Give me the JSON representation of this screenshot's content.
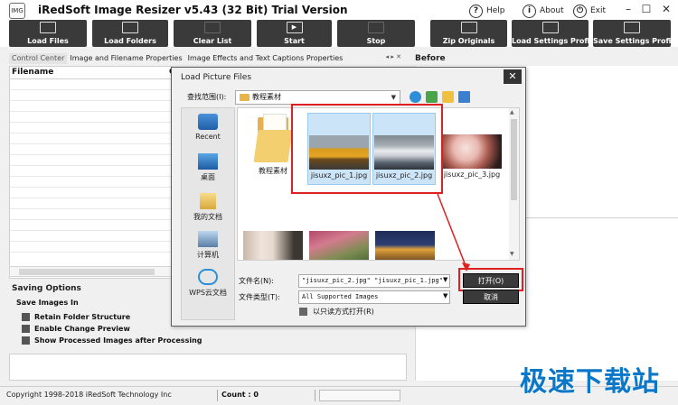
{
  "window": {
    "title": "iRedSoft Image Resizer v5.43 (32 Bit) Trial Version",
    "app_icon_text": "IMG",
    "links": [
      {
        "label": "Help",
        "icon": "?"
      },
      {
        "label": "About",
        "icon": "i"
      },
      {
        "label": "Exit",
        "icon": "⏻"
      }
    ],
    "controls": {
      "minimize": "–",
      "maximize": "☐",
      "close": "✕"
    }
  },
  "toolbar": {
    "buttons": [
      {
        "label": "Load Files",
        "icon": "image-icon"
      },
      {
        "label": "Load Folders",
        "icon": "image-icon"
      },
      {
        "label": "Clear List",
        "icon": "blank-icon"
      },
      {
        "label": "Start",
        "icon": "play-icon"
      },
      {
        "label": "Stop",
        "icon": "stop-icon"
      },
      {
        "label": "Zip Originals",
        "icon": "image-icon"
      },
      {
        "label": "Load Settings Profile",
        "icon": "image-icon"
      },
      {
        "label": "Save Settings Profile",
        "icon": "image-icon"
      }
    ]
  },
  "tabs": [
    "Control Center",
    "Image and Filename Properties",
    "Image Effects and Text Captions Properties"
  ],
  "tab_arrows": "◂ ▸ ✕",
  "preview": {
    "before_label": "Before"
  },
  "file_list": {
    "header": "Filename",
    "second_header": "C"
  },
  "saving": {
    "header": "Saving Options",
    "tab": "Save Images In",
    "options": [
      "Retain Folder Structure",
      "Enable Change Preview",
      "Show Processed Images after Processing"
    ]
  },
  "statusbar": {
    "copyright": "Copyright 1998-2018 iRedSoft Technology Inc",
    "count": "Count : 0"
  },
  "dialog": {
    "title": "Load Picture Files",
    "close": "✕",
    "look_in_label": "查找范围(I):",
    "look_in_value": "教程素材",
    "places": [
      {
        "label": "Recent",
        "icon": "recent-places-icon"
      },
      {
        "label": "桌面",
        "icon": "desktop-icon"
      },
      {
        "label": "我的文档",
        "icon": "documents-icon"
      },
      {
        "label": "计算机",
        "icon": "computer-icon"
      },
      {
        "label": "WPS云文档",
        "icon": "cloud-icon"
      }
    ],
    "files": [
      {
        "name": "教程素材",
        "kind": "folder"
      },
      {
        "name": "jisuxz_pic_1.jpg",
        "kind": "image",
        "selected": true,
        "colors": [
          "#d79b1f",
          "#6b4a1c"
        ]
      },
      {
        "name": "jisuxz_pic_2.jpg",
        "kind": "image",
        "selected": true,
        "colors": [
          "#c9cdd2",
          "#57626e"
        ]
      },
      {
        "name": "jisuxz_pic_3.jpg",
        "kind": "image",
        "selected": false,
        "colors": [
          "#f2d9d6",
          "#a9594e"
        ]
      },
      {
        "name": "",
        "kind": "image",
        "colors": [
          "#e6d9cf",
          "#3c3631"
        ]
      },
      {
        "name": "",
        "kind": "image",
        "colors": [
          "#b24a6a",
          "#4d6a3a"
        ]
      },
      {
        "name": "",
        "kind": "image",
        "colors": [
          "#1f2c57",
          "#e0a13c"
        ]
      }
    ],
    "filename_label": "文件名(N):",
    "filename_value": "\"jisuxz_pic_2.jpg\" \"jisuxz_pic_1.jpg\"",
    "filetype_label": "文件类型(T):",
    "filetype_value": "All Supported Images",
    "readonly_label": "以只读方式打开(R)",
    "open_button": "打开(O)",
    "cancel_button": "取消"
  },
  "watermark": "极速下载站",
  "colors": {
    "toolbar_button": "#3a3a3a",
    "highlight_box": "#e02020",
    "watermark": "#0b77c9"
  }
}
